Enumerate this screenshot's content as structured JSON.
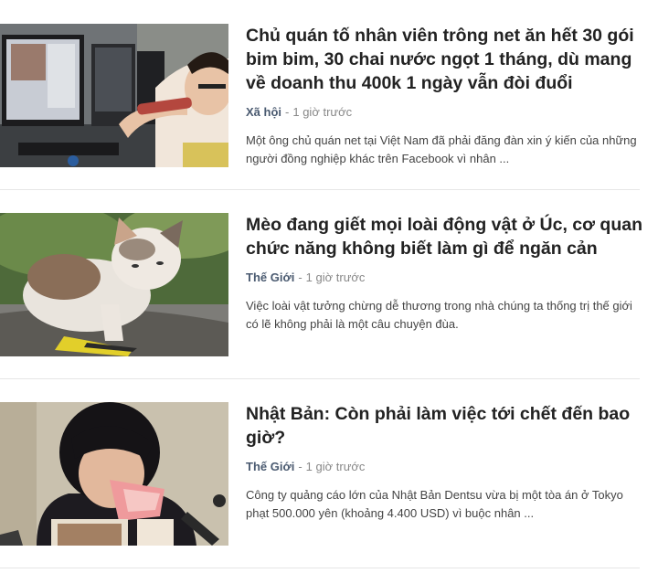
{
  "articles": [
    {
      "title": "Chủ quán tố nhân viên trông net ăn hết 30 gói bim bim, 30 chai nước ngọt 1 tháng, dù mang về doanh thu 400k 1 ngày vẫn đòi đuổi",
      "category": "Xã hội",
      "separator": "-",
      "time": "1 giờ trước",
      "summary": "Một ông chủ quán net tại Việt Nam đã phải đăng đàn xin ý kiến của những người đồng nghiệp khác trên Facebook vì nhân ..."
    },
    {
      "title": "Mèo đang giết mọi loài động vật ở Úc, cơ quan chức năng không biết làm gì để ngăn cản",
      "category": "Thế Giới",
      "separator": "-",
      "time": "1 giờ trước",
      "summary": "Việc loài vật tưởng chừng dễ thương trong nhà chúng ta thống trị thế giới có lẽ không phải là một câu chuyện đùa."
    },
    {
      "title": "Nhật Bản: Còn phải làm việc tới chết đến bao giờ?",
      "category": "Thế Giới",
      "separator": "-",
      "time": "1 giờ trước",
      "summary": "Công ty quảng cáo lớn của Nhật Bản Dentsu vừa bị một tòa án ở Tokyo phạt 500.000 yên (khoảng 4.400 USD) vì buộc nhân ..."
    }
  ]
}
